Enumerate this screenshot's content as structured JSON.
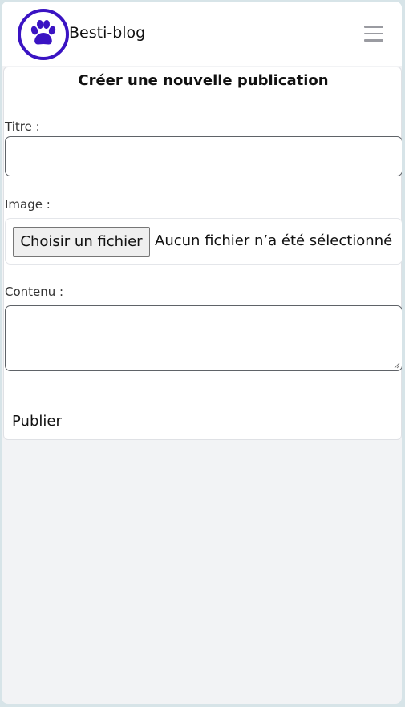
{
  "app": {
    "brand_name": "Besti-blog",
    "logo_icon": "paw-icon",
    "menu_icon": "hamburger-menu-icon",
    "accent_color": "#3a13c3"
  },
  "form": {
    "title": "Créer une nouvelle publication",
    "title_label": "Titre :",
    "title_value": "",
    "image_label": "Image :",
    "file_button_label": "Choisir un fichier",
    "file_status": "Aucun fichier n’a été sélectionné",
    "content_label": "Contenu :",
    "content_value": "",
    "submit_label": "Publier"
  }
}
